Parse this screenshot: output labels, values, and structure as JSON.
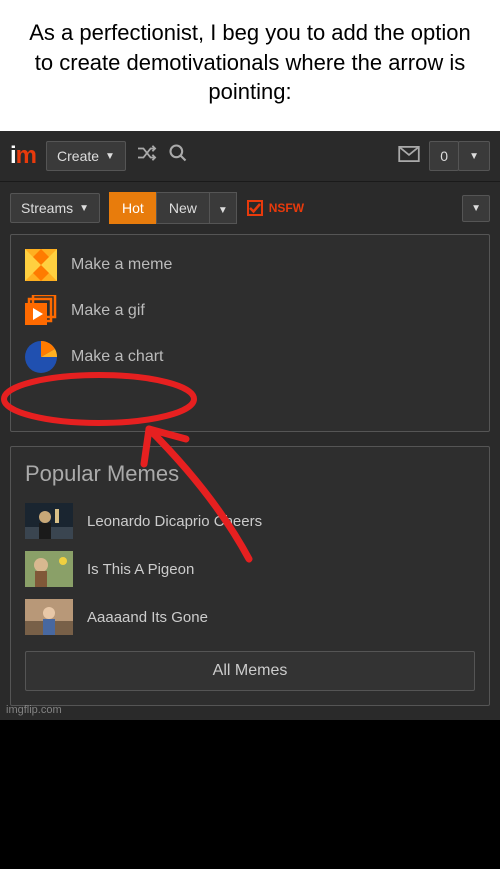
{
  "caption": "As a perfectionist, I beg you to add the option to create demotivationals where the arrow is pointing:",
  "topbar": {
    "logo_i": "i",
    "logo_m": "m",
    "create_label": "Create",
    "notif_count": "0"
  },
  "filterbar": {
    "streams_label": "Streams",
    "hot_label": "Hot",
    "new_label": "New",
    "nsfw_label": "NSFW"
  },
  "make": {
    "meme": "Make a meme",
    "gif": "Make a gif",
    "chart": "Make a chart"
  },
  "popular": {
    "title": "Popular Memes",
    "items": [
      {
        "label": "Leonardo Dicaprio Cheers"
      },
      {
        "label": "Is This A Pigeon"
      },
      {
        "label": "Aaaaand Its Gone"
      }
    ],
    "all_label": "All Memes"
  },
  "watermark": "imgflip.com"
}
